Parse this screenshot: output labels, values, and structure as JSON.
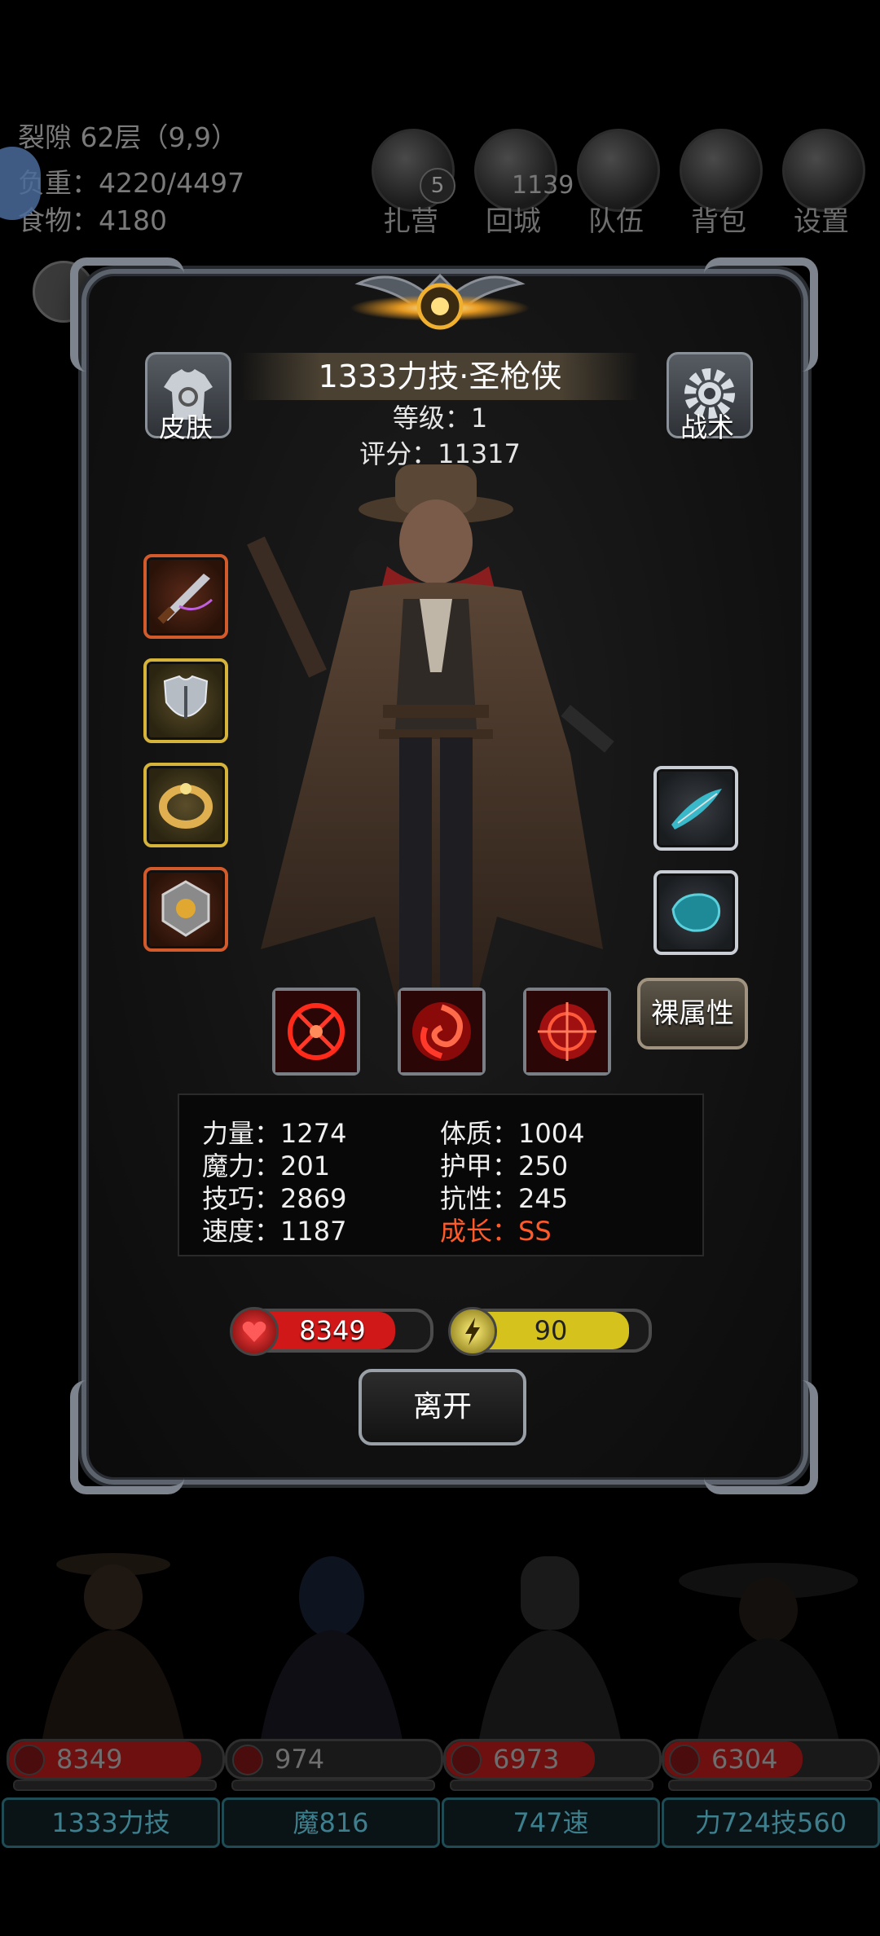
{
  "hud": {
    "location": "裂隙 62层（9,9）",
    "weight": "负重：4220/4497",
    "food": "食物：4180",
    "buttons": [
      {
        "label": "扎营",
        "icon": "camp-icon",
        "badge": "5"
      },
      {
        "label": "回城",
        "icon": "portal-icon",
        "badge": "1139"
      },
      {
        "label": "队伍",
        "icon": "team-icon"
      },
      {
        "label": "背包",
        "icon": "bag-icon"
      },
      {
        "label": "设置",
        "icon": "gear-icon"
      }
    ]
  },
  "character": {
    "name": "1333力技·圣枪侠",
    "level": "等级：1",
    "score": "评分：11317",
    "skin_label": "皮肤",
    "tactics_label": "战术",
    "naked_attr_label": "裸属性",
    "equipment_left": [
      {
        "name": "weapon-slot",
        "icon": "dagger-icon",
        "color": "#d35a2a"
      },
      {
        "name": "armor-slot",
        "icon": "chestplate-icon",
        "color": "#d6b43a"
      },
      {
        "name": "ring-slot",
        "icon": "ring-icon",
        "color": "#d6b43a"
      },
      {
        "name": "amulet-slot",
        "icon": "amulet-icon",
        "color": "#d35a2a"
      }
    ],
    "equipment_right": [
      {
        "name": "trinket-slot",
        "icon": "feather-icon",
        "color": "#c9ced4"
      },
      {
        "name": "gem-slot",
        "icon": "gem-icon",
        "color": "#c9ced4"
      }
    ],
    "skills": [
      {
        "icon": "crosshair-skill-icon"
      },
      {
        "icon": "swirl-skill-icon"
      },
      {
        "icon": "target-skill-icon"
      }
    ],
    "stats": {
      "strength": "力量：1274",
      "constitution": "体质：1004",
      "magic": "魔力：201",
      "armor": "护甲：250",
      "skill": "技巧：2869",
      "resistance": "抗性：245",
      "speed": "速度：1187",
      "growth": "成长：SS"
    },
    "hp": {
      "value": "8349",
      "fill": 0.82,
      "color": "#d01818"
    },
    "energy": {
      "value": "90",
      "fill": 0.9,
      "color": "#d6c21c"
    },
    "leave_label": "离开"
  },
  "team": [
    {
      "hp": "8349",
      "hp_fill": 0.9,
      "name": "1333力技"
    },
    {
      "hp": "974",
      "hp_fill": 0.0,
      "name": "魔816"
    },
    {
      "hp": "6973",
      "hp_fill": 0.7,
      "name": "747速"
    },
    {
      "hp": "6304",
      "hp_fill": 0.65,
      "name": "力724技560"
    }
  ]
}
